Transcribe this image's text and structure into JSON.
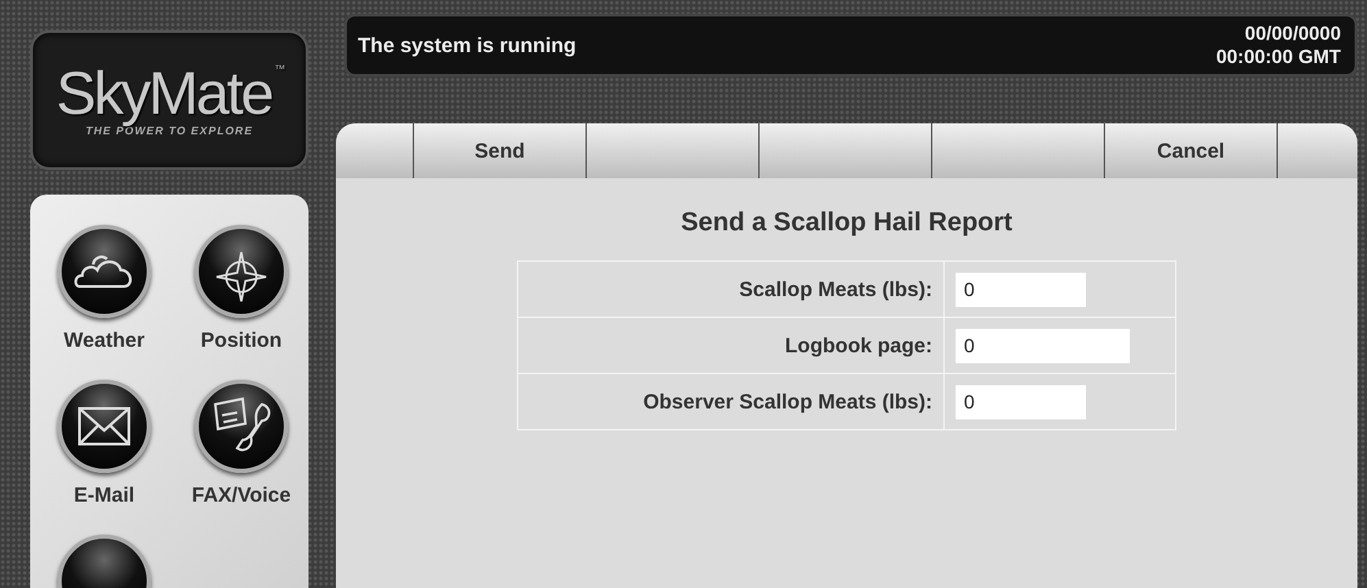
{
  "logo": {
    "name": "SkyMate",
    "mark": "™",
    "tagline": "THE POWER TO EXPLORE"
  },
  "nav": [
    {
      "kind": "weather",
      "label": "Weather"
    },
    {
      "kind": "position",
      "label": "Position"
    },
    {
      "kind": "email",
      "label": "E-Mail"
    },
    {
      "kind": "fax",
      "label": "FAX/Voice"
    },
    {
      "kind": "partial"
    }
  ],
  "status_bar": {
    "message": "The system is running",
    "date": "00/00/0000",
    "time": "00:00:00 GMT"
  },
  "toolbar": [
    {
      "label": "Send"
    },
    {
      "label": "Cancel"
    }
  ],
  "form": {
    "title": "Send a Scallop Hail Report",
    "fields": [
      {
        "label": "Scallop Meats (lbs):",
        "value": "0",
        "kind": "short"
      },
      {
        "label": "Logbook page:",
        "value": "0",
        "kind": "long"
      },
      {
        "label": "Observer Scallop Meats (lbs):",
        "value": "0",
        "kind": "short"
      }
    ]
  }
}
